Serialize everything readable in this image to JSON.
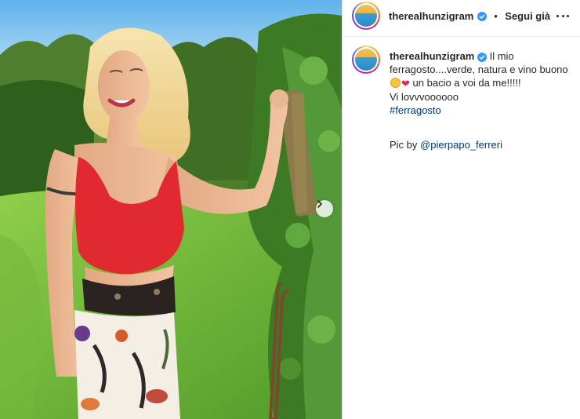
{
  "post": {
    "username": "therealhunzigram",
    "follow_label": "Segui già",
    "separator": "•",
    "caption": {
      "username": "therealhunzigram",
      "line1": "Il mio ferragosto....verde, natura e vino buono",
      "line2": "un bacio a voi da me!!!!!",
      "line3": "Vi lovvvoooooo",
      "hashtag": "#ferragosto",
      "credit_prefix": "Pic by",
      "credit_mention": "@pierpapo_ferreri"
    },
    "icons": {
      "avatar": "avatar",
      "verified": "verified-badge-icon",
      "more": "more-options-icon",
      "next": "chevron-right-icon",
      "emoji1": "grinning-face-emoji",
      "emoji2": "red-heart-emoji"
    }
  },
  "colors": {
    "verified": "#3897f0",
    "link": "#00376b",
    "text": "#262626"
  }
}
